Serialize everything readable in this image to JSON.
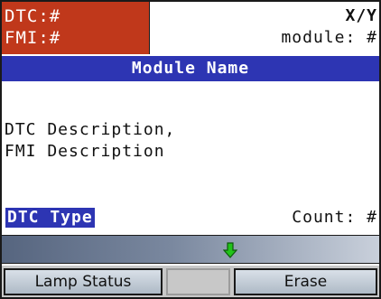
{
  "header": {
    "dtc_label": "DTC:#",
    "fmi_label": "FMI:#",
    "position": "X/Y",
    "module_label": "module: #"
  },
  "module_name": "Module Name",
  "description": {
    "line1": "DTC Description,",
    "line2": "FMI Description"
  },
  "footer_info": {
    "dtc_type": "DTC Type",
    "count_label": "Count:  #"
  },
  "scroll": {
    "icon": "down-arrow-icon",
    "arrow_color": "#22c41a"
  },
  "softkeys": {
    "left": "Lamp Status",
    "middle": "",
    "right": "Erase"
  },
  "colors": {
    "dtc_background": "#c0381b",
    "module_bar": "#2d35b3"
  }
}
